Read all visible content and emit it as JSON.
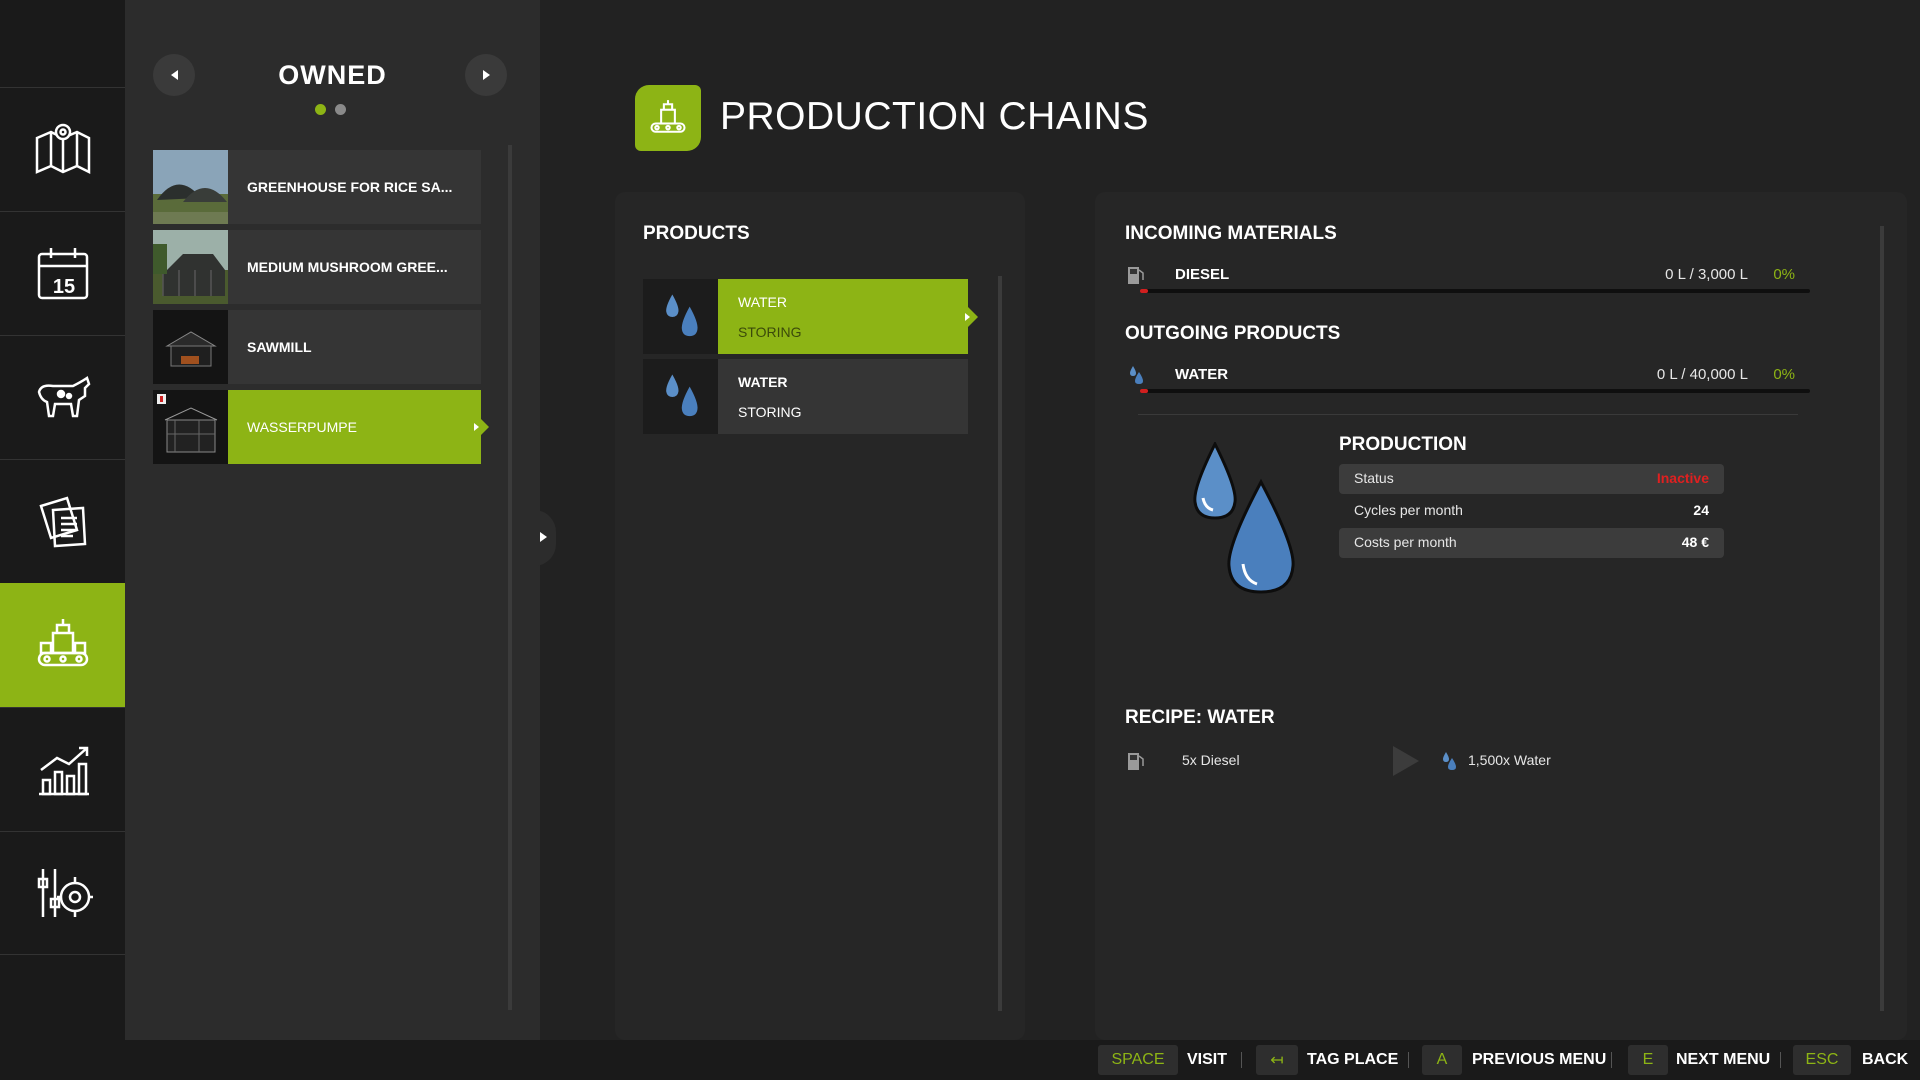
{
  "colors": {
    "accent": "#8db415",
    "inactive": "#e02020",
    "bg": "#222222"
  },
  "sidebar": {
    "items": [
      {
        "icon": "map-icon"
      },
      {
        "icon": "calendar-icon",
        "day": "15"
      },
      {
        "icon": "animals-icon"
      },
      {
        "icon": "contracts-icon"
      },
      {
        "icon": "production-icon",
        "active": true
      },
      {
        "icon": "statistics-icon"
      },
      {
        "icon": "settings-icon"
      }
    ]
  },
  "owned": {
    "title": "OWNED",
    "places": [
      {
        "label": "GREENHOUSE FOR RICE SA..."
      },
      {
        "label": "MEDIUM MUSHROOM GREE..."
      },
      {
        "label": "SAWMILL"
      },
      {
        "label": "WASSERPUMPE",
        "active": true
      }
    ]
  },
  "header": {
    "title": "PRODUCTION CHAINS"
  },
  "products": {
    "heading": "PRODUCTS",
    "items": [
      {
        "name": "WATER",
        "state": "STORING",
        "active": true
      },
      {
        "name": "WATER",
        "state": "STORING"
      }
    ]
  },
  "incoming": {
    "heading": "INCOMING MATERIALS",
    "items": [
      {
        "name": "DIESEL",
        "amount": "0 L / 3,000 L",
        "percent": "0%",
        "fill": 0
      }
    ]
  },
  "outgoing": {
    "heading": "OUTGOING PRODUCTS",
    "items": [
      {
        "name": "WATER",
        "amount": "0 L / 40,000 L",
        "percent": "0%",
        "fill": 0
      }
    ]
  },
  "production": {
    "heading": "PRODUCTION",
    "status_label": "Status",
    "status_value": "Inactive",
    "cycles_label": "Cycles per month",
    "cycles_value": "24",
    "costs_label": "Costs per month",
    "costs_value": "48 €"
  },
  "recipe": {
    "heading": "RECIPE: WATER",
    "input": "5x Diesel",
    "output": "1,500x Water"
  },
  "footer": {
    "actions": [
      {
        "key": "SPACE",
        "label": "VISIT"
      },
      {
        "key": "↤",
        "label": "TAG PLACE"
      },
      {
        "key": "A",
        "label": "PREVIOUS MENU"
      },
      {
        "key": "E",
        "label": "NEXT MENU"
      },
      {
        "key": "ESC",
        "label": "BACK"
      }
    ]
  }
}
